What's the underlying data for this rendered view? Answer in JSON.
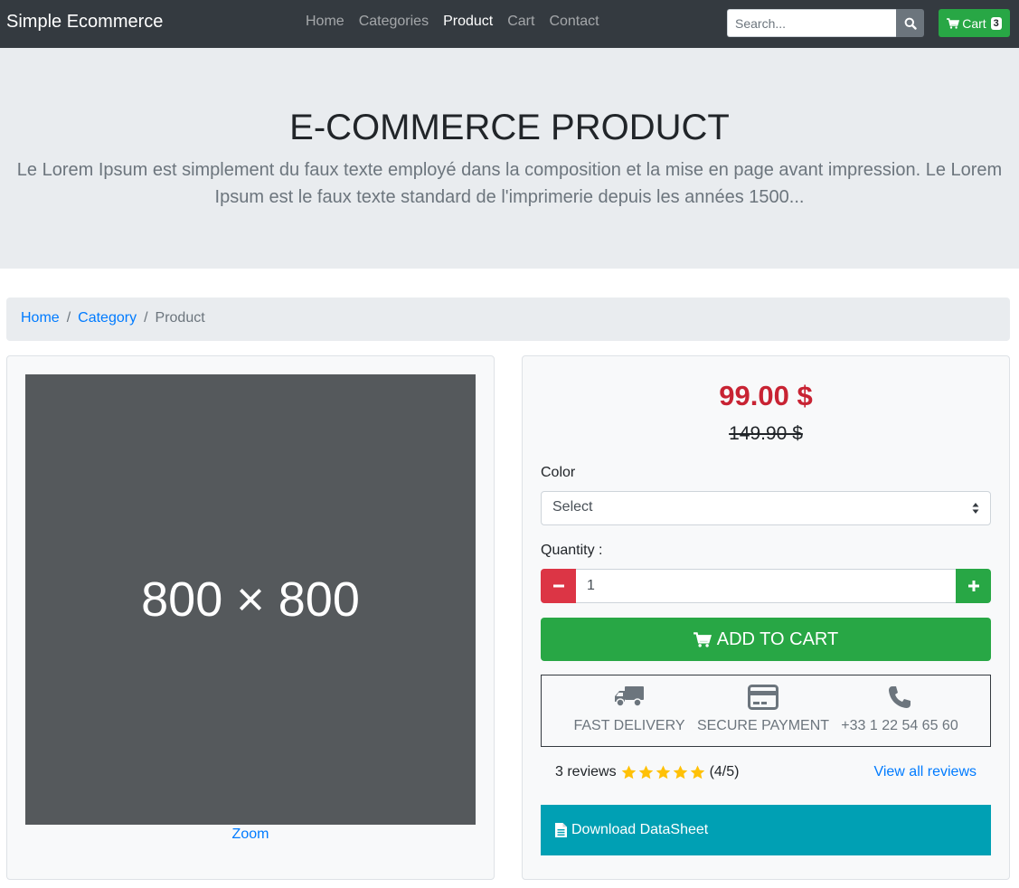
{
  "navbar": {
    "brand": "Simple Ecommerce",
    "links": [
      "Home",
      "Categories",
      "Product",
      "Cart",
      "Contact"
    ],
    "active_link": "Product",
    "search_placeholder": "Search...",
    "cart_label": "Cart",
    "cart_count": "3"
  },
  "hero": {
    "title": "E-COMMERCE PRODUCT",
    "text": "Le Lorem Ipsum est simplement du faux texte employé dans la composition et la mise en page avant impression. Le Lorem Ipsum est le faux texte standard de l'imprimerie depuis les années 1500..."
  },
  "breadcrumb": {
    "items": [
      "Home",
      "Category"
    ],
    "current": "Product"
  },
  "product": {
    "image_placeholder": "800 × 800",
    "zoom_label": "Zoom",
    "price": "99.00 $",
    "old_price": "149.90 $",
    "color_label": "Color",
    "color_selected": "Select",
    "quantity_label": "Quantity :",
    "quantity_value": "1",
    "add_to_cart": "ADD TO CART",
    "features": [
      {
        "icon": "truck-icon",
        "label": "FAST DELIVERY"
      },
      {
        "icon": "credit-card-icon",
        "label": "SECURE PAYMENT"
      },
      {
        "icon": "phone-icon",
        "label": "+33 1 22 54 65 60"
      }
    ],
    "reviews_count": "3 reviews",
    "rating_text": "(4/5)",
    "rating": 5,
    "view_all": "View all reviews",
    "download": "Download DataSheet"
  },
  "colors": {
    "navbar_bg": "#343a40",
    "success": "#28a745",
    "danger": "#dc3545",
    "price_red": "#c82333",
    "link": "#007bff",
    "info": "#00a0b4",
    "star": "#ffc107"
  }
}
